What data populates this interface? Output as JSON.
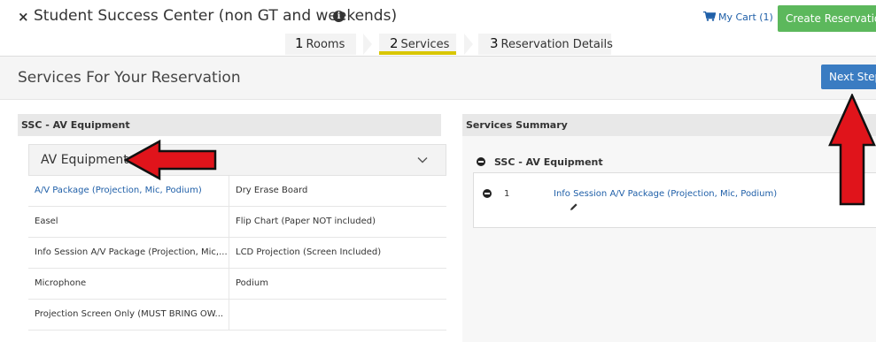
{
  "header": {
    "close_symbol": "×",
    "title": "Student Success Center (non GT and weekends)",
    "info_symbol": "i",
    "cart_label": "My Cart (1)",
    "create_reservation_label": "Create Reservation"
  },
  "steps": [
    {
      "num": "1",
      "label": "Rooms"
    },
    {
      "num": "2",
      "label": "Services"
    },
    {
      "num": "3",
      "label": "Reservation Details"
    }
  ],
  "subheader": {
    "title": "Services For Your Reservation",
    "next_label": "Next Step"
  },
  "left_panel": {
    "header": "SSC - AV Equipment",
    "group_title": "AV Equipment",
    "rows": [
      [
        "A/V Package (Projection, Mic, Podium)",
        "Dry Erase Board"
      ],
      [
        "Easel",
        "Flip Chart (Paper NOT included)"
      ],
      [
        "Info Session A/V Package (Projection, Mic,...",
        "LCD Projection (Screen Included)"
      ],
      [
        "Microphone",
        "Podium"
      ],
      [
        "Projection Screen Only (MUST BRING OW...",
        ""
      ]
    ]
  },
  "right_panel": {
    "header": "Services Summary",
    "group_title": "SSC - AV Equipment",
    "item_qty": "1",
    "item_name": "Info Session A/V Package (Projection, Mic, Podium)"
  },
  "colors": {
    "accent_green": "#5cb85c",
    "accent_blue": "#3a7cc2",
    "active_step": "#d9c600",
    "annotation_red": "#e0141b"
  }
}
